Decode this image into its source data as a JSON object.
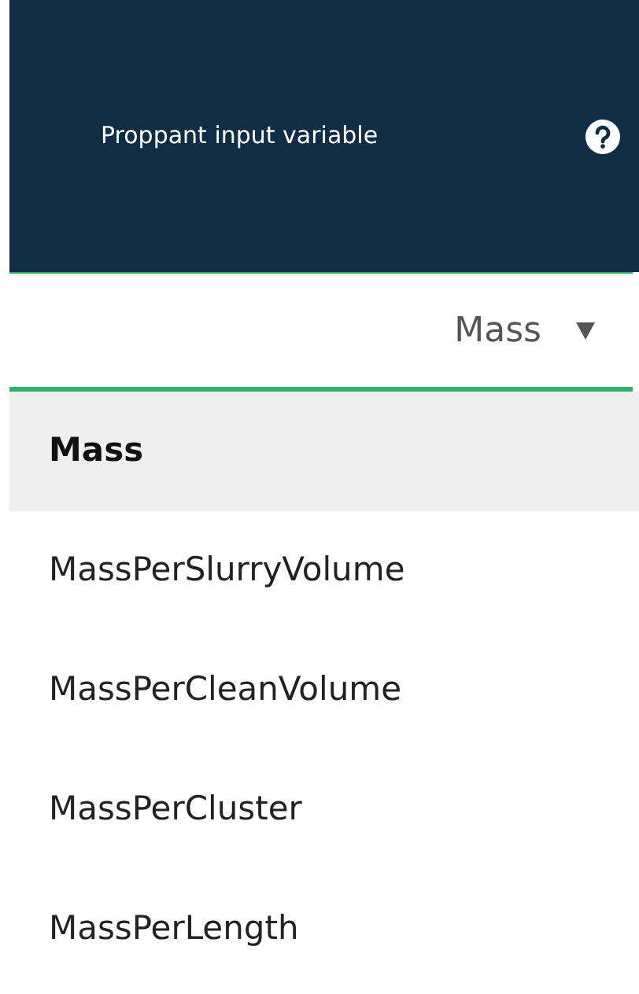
{
  "header": {
    "label": "Proppant input variable"
  },
  "select": {
    "value": "Mass",
    "open": true
  },
  "options": [
    {
      "label": "Mass",
      "selected": true
    },
    {
      "label": "MassPerSlurryVolume",
      "selected": false
    },
    {
      "label": "MassPerCleanVolume",
      "selected": false
    },
    {
      "label": "MassPerCluster",
      "selected": false
    },
    {
      "label": "MassPerLength",
      "selected": false
    }
  ]
}
